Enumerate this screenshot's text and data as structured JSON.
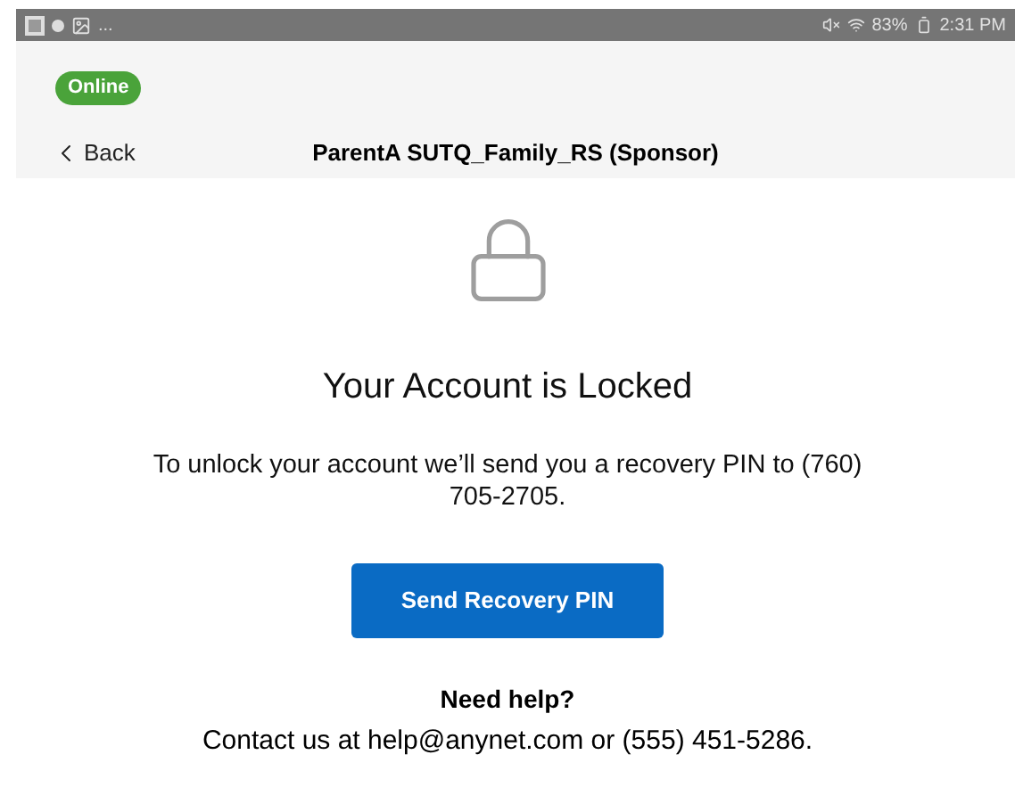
{
  "status_bar": {
    "notifications_more": "...",
    "battery": "83%",
    "time": "2:31 PM"
  },
  "connection": {
    "label": "Online",
    "online": true
  },
  "nav": {
    "back": "Back",
    "title": "ParentA SUTQ_Family_RS (Sponsor)"
  },
  "locked": {
    "heading": "Your Account is Locked",
    "message": "To unlock your account we’ll send you a recovery PIN to (760) 705-2705.",
    "button": "Send Recovery PIN"
  },
  "help": {
    "heading": "Need help?",
    "text": "Contact us at help@anynet.com or (555) 451-5286."
  }
}
